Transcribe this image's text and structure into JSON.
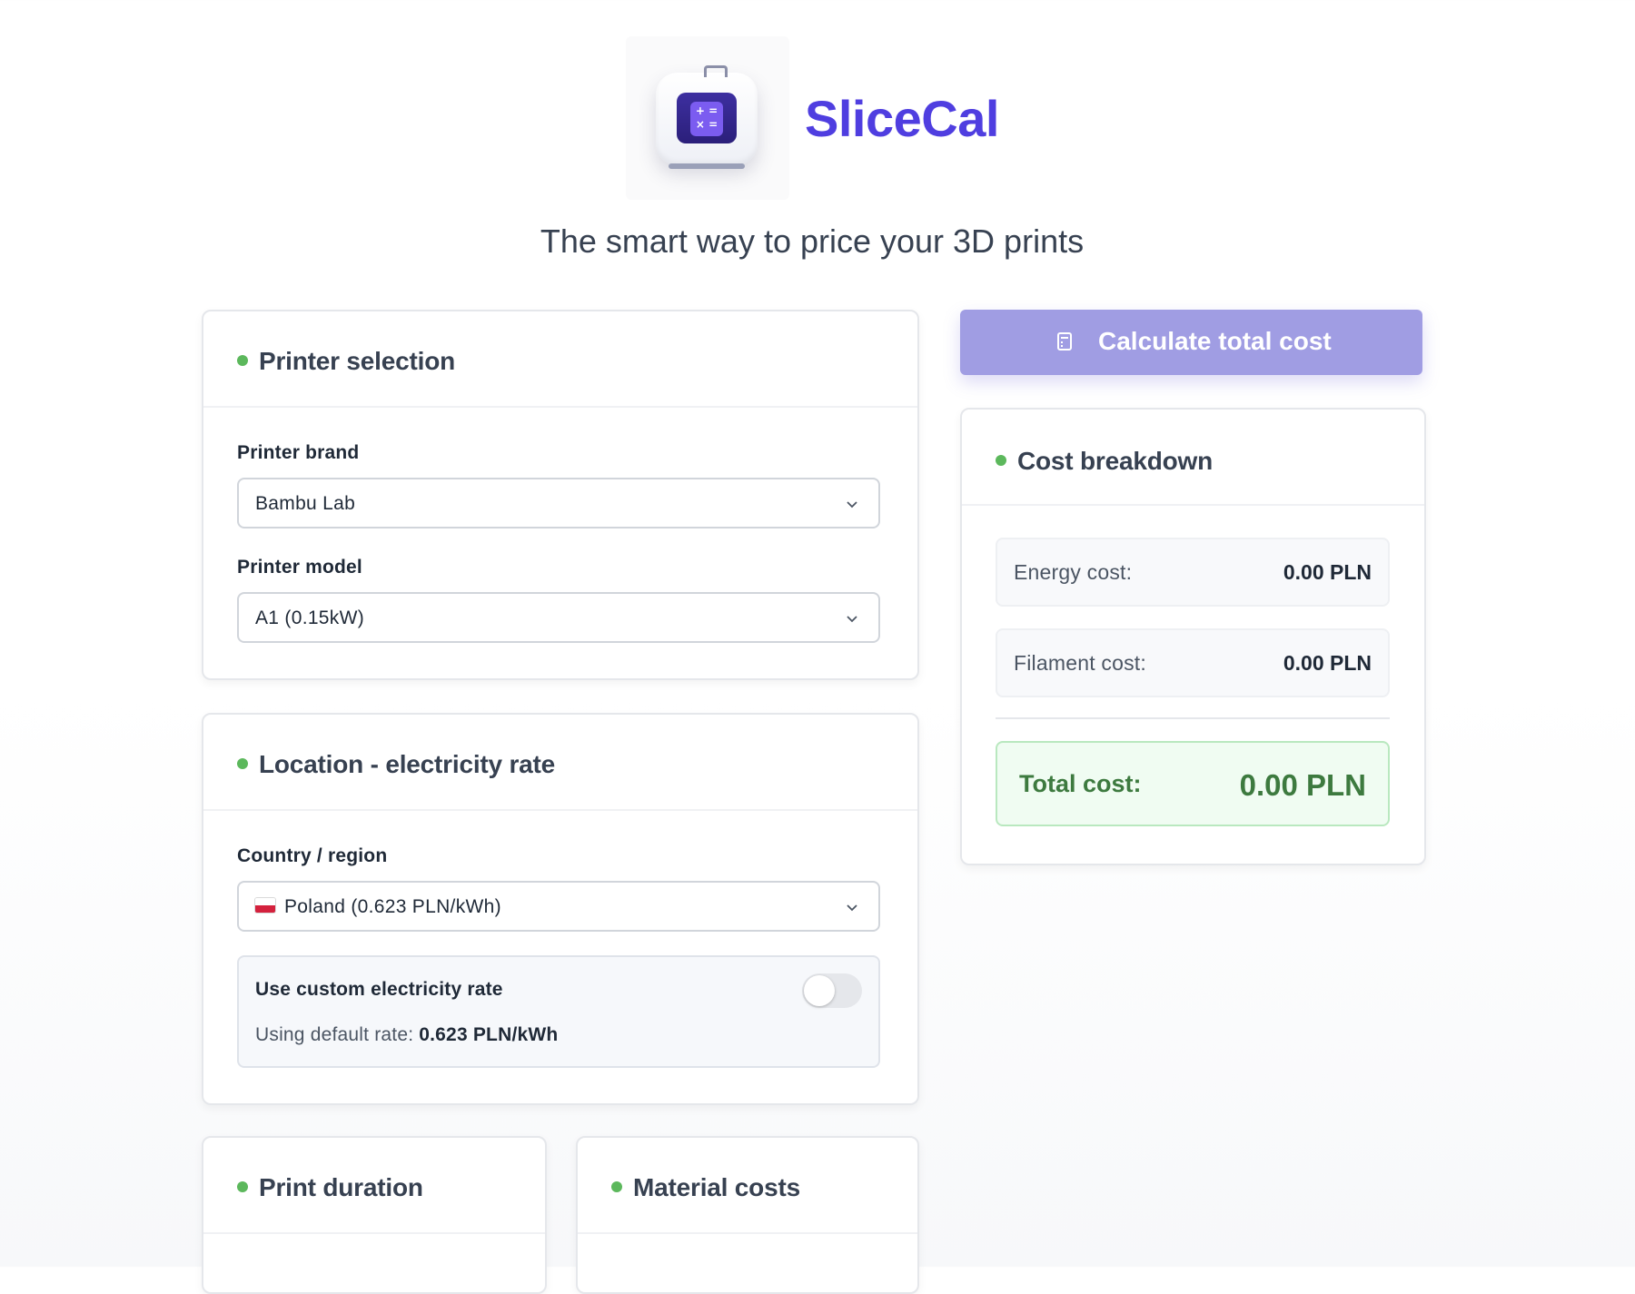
{
  "app": {
    "name": "SliceCal",
    "tagline": "The smart way to price your 3D prints",
    "logo_symbols": "+ =\n× ="
  },
  "printer": {
    "title": "Printer selection",
    "brand_label": "Printer brand",
    "brand_value": "Bambu Lab",
    "model_label": "Printer model",
    "model_value": "A1 (0.15kW)"
  },
  "location": {
    "title": "Location - electricity rate",
    "country_label": "Country / region",
    "country_value": "Poland (0.623 PLN/kWh)",
    "custom_rate_label": "Use custom electricity rate",
    "custom_rate_enabled": false,
    "default_rate_prefix": "Using default rate: ",
    "default_rate_value": "0.623 PLN/kWh"
  },
  "duration": {
    "title": "Print duration"
  },
  "material": {
    "title": "Material costs"
  },
  "calculate": {
    "label": "Calculate total cost"
  },
  "breakdown": {
    "title": "Cost breakdown",
    "energy_label": "Energy cost:",
    "energy_value": "0.00 PLN",
    "filament_label": "Filament cost:",
    "filament_value": "0.00 PLN",
    "total_label": "Total cost:",
    "total_value": "0.00 PLN"
  },
  "colors": {
    "brand": "#4f3ee0",
    "button": "#a09de3",
    "section_dot": "#5cb85c",
    "total_text": "#3d7a3f"
  },
  "icons": [
    "printer-calculator-logo",
    "chevron-down-icon",
    "poland-flag-icon",
    "calculator-icon"
  ]
}
